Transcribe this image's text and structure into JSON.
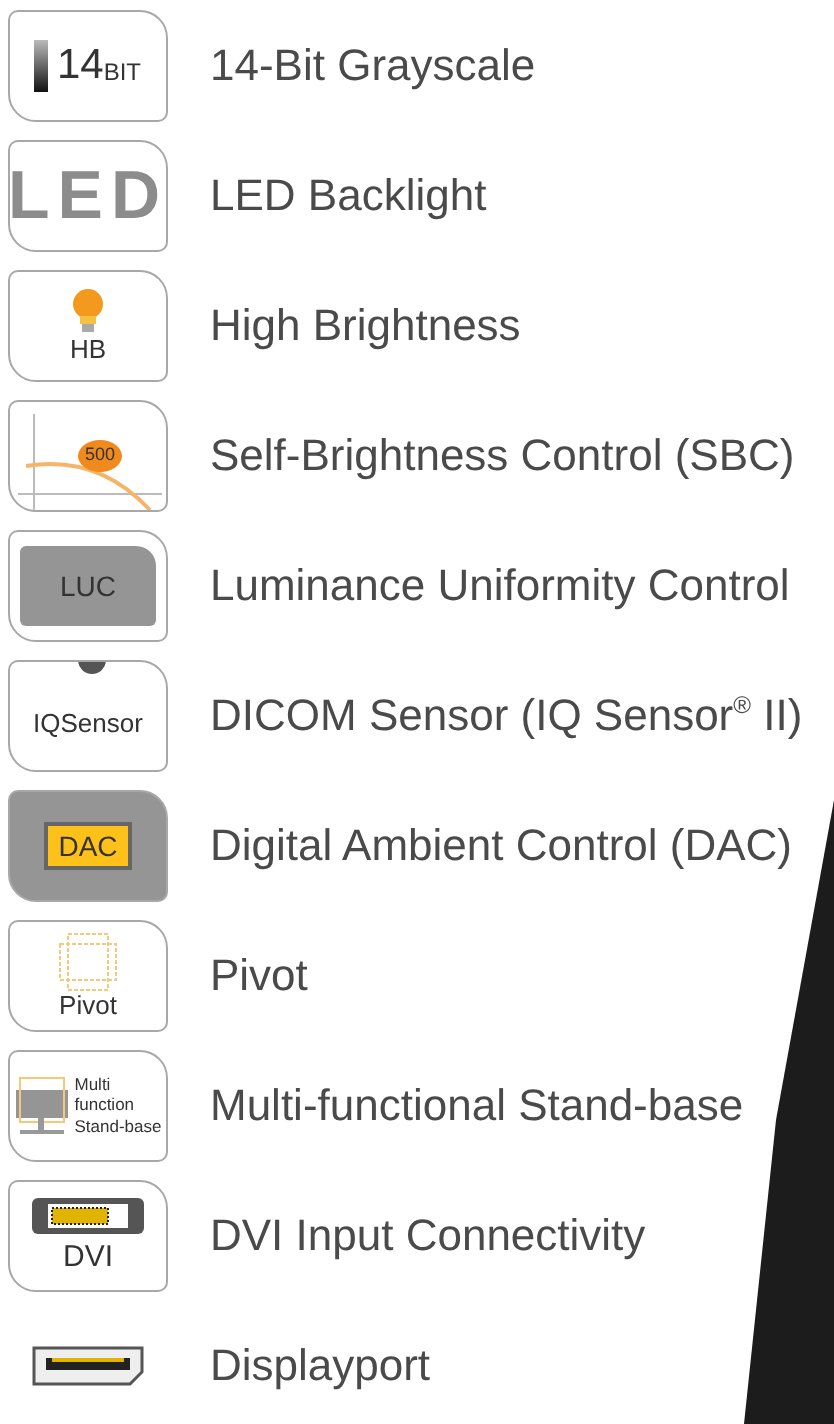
{
  "features": [
    {
      "kind": "bit",
      "icon_text": "14",
      "icon_subtext": "BIT",
      "label": "14-Bit Grayscale"
    },
    {
      "kind": "led",
      "icon_text": "LED",
      "label": "LED Backlight"
    },
    {
      "kind": "bulb",
      "icon_text": "HB",
      "label": "High Brightness"
    },
    {
      "kind": "sbc",
      "icon_text": "500",
      "label": "Self-Brightness Control (SBC)"
    },
    {
      "kind": "luc",
      "icon_text": "LUC",
      "label": "Luminance Uniformity Control"
    },
    {
      "kind": "sensor",
      "icon_text": "IQSensor",
      "label": "DICOM Sensor (IQ Sensor$^{®}$ II)"
    },
    {
      "kind": "dac",
      "icon_text": "DAC",
      "label": "Digital Ambient Control (DAC)"
    },
    {
      "kind": "pivot",
      "icon_text": "Pivot",
      "label": "Pivot"
    },
    {
      "kind": "stand",
      "icon_lines": [
        "Multi",
        "function",
        "Stand-base"
      ],
      "label": "Multi-functional Stand-base"
    },
    {
      "kind": "dvi",
      "icon_text": "DVI",
      "label": "DVI Input Connectivity"
    },
    {
      "kind": "dp",
      "label": "Displayport"
    }
  ]
}
